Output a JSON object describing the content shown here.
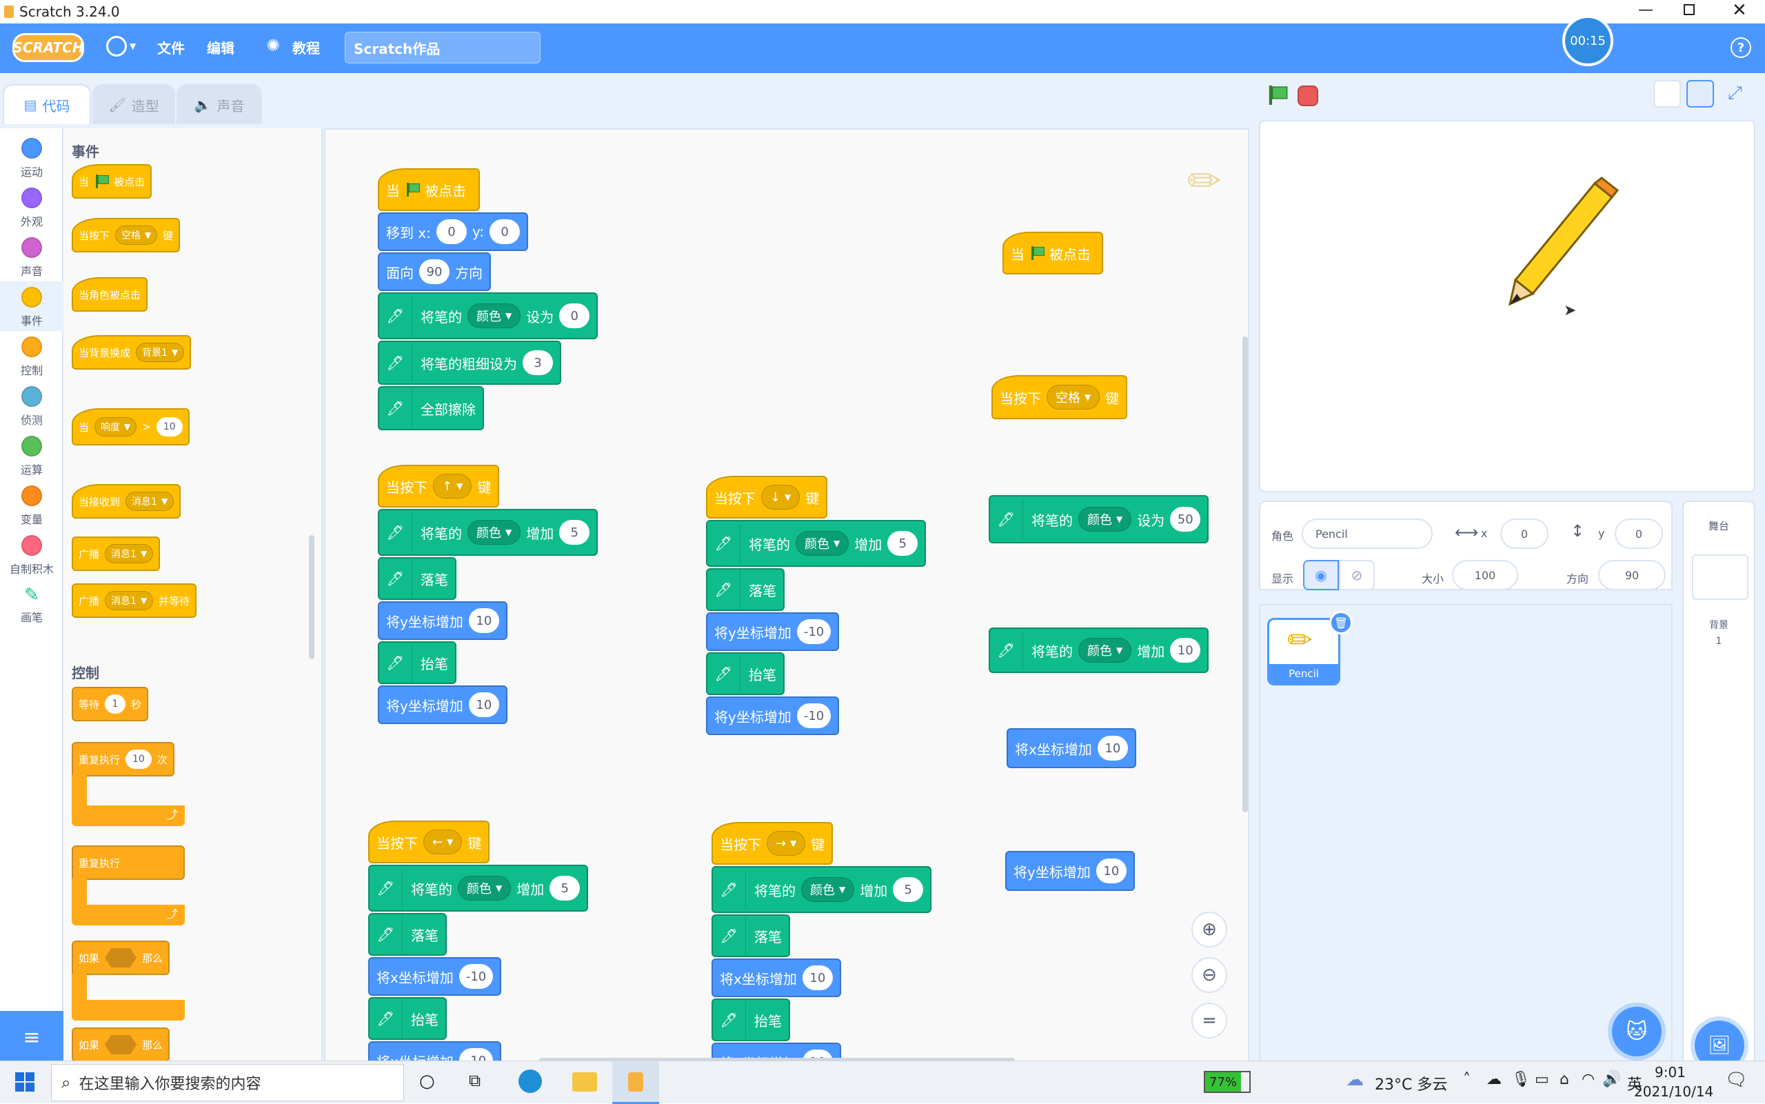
{
  "window": {
    "title": "Scratch 3.24.0",
    "timer": "00:15"
  },
  "menu": {
    "logo": "SCRATCH",
    "file": "文件",
    "edit": "编辑",
    "tutorials": "教程",
    "project_title": "Scratch作品",
    "help": "?"
  },
  "tabs": {
    "code": "代码",
    "costumes": "造型",
    "sounds": "声音"
  },
  "categories": [
    {
      "label": "运动",
      "color": "#4c97ff"
    },
    {
      "label": "外观",
      "color": "#9966ff"
    },
    {
      "label": "声音",
      "color": "#cf63cf"
    },
    {
      "label": "事件",
      "color": "#ffbf00"
    },
    {
      "label": "控制",
      "color": "#ffab19"
    },
    {
      "label": "侦测",
      "color": "#5cb1d6"
    },
    {
      "label": "运算",
      "color": "#59c059"
    },
    {
      "label": "变量",
      "color": "#ff8c1a"
    },
    {
      "label": "自制积木",
      "color": "#ff6680"
    },
    {
      "label": "画笔",
      "color": "#0fbd8c"
    }
  ],
  "palette": {
    "events_title": "事件",
    "when": "当",
    "clicked": "被点击",
    "when_key_pressed": "当按下",
    "space": "空格",
    "key": "键",
    "when_sprite_clicked": "当角色被点击",
    "when_backdrop": "当背景换成",
    "backdrop1": "背景1",
    "loudness": "响度",
    "gt": ">",
    "ten": "10",
    "when_receive": "当接收到",
    "message1": "消息1",
    "broadcast": "广播",
    "and_wait": "并等待",
    "control_title": "控制",
    "wait": "等待",
    "one": "1",
    "seconds": "秒",
    "repeat": "重复执行",
    "times": "次",
    "forever": "重复执行",
    "if": "如果",
    "then": "那么"
  },
  "code": {
    "when": "当",
    "clicked": "被点击",
    "when_key": "当按下",
    "key": "键",
    "goto_x": "移到 x:",
    "y_label": "y:",
    "x_val": "0",
    "y_val": "0",
    "point_dir": "面向",
    "dir_val": "90",
    "direction": "方向",
    "pen_of": "将笔的",
    "color": "颜色",
    "set_to": "设为",
    "change_by": "增加",
    "set_size": "将笔的粗细设为",
    "size_val": "3",
    "clear": "全部擦除",
    "pen_down": "落笔",
    "pen_up": "抬笔",
    "change_y": "将y坐标增加",
    "change_x": "将x坐标增加",
    "zero": "0",
    "five": "5",
    "ten": "10",
    "neg_ten": "-10",
    "fifty": "50",
    "up": "↑",
    "down": "↓",
    "left": "←",
    "right": "→",
    "space": "空格"
  },
  "sprite": {
    "label": "角色",
    "name": "Pencil",
    "x_label": "x",
    "x": "0",
    "y_label": "y",
    "y": "0",
    "show_label": "显示",
    "size_label": "大小",
    "size": "100",
    "direction_label": "方向",
    "direction": "90",
    "thumb_name": "Pencil"
  },
  "stage_panel": {
    "title": "舞台",
    "backdrops_label": "背景",
    "backdrops_count": "1"
  },
  "taskbar": {
    "search_placeholder": "在这里输入你要搜索的内容",
    "battery": "77%",
    "weather": "23°C 多云",
    "ime": "英",
    "time": "9:01",
    "date": "2021/10/14"
  }
}
